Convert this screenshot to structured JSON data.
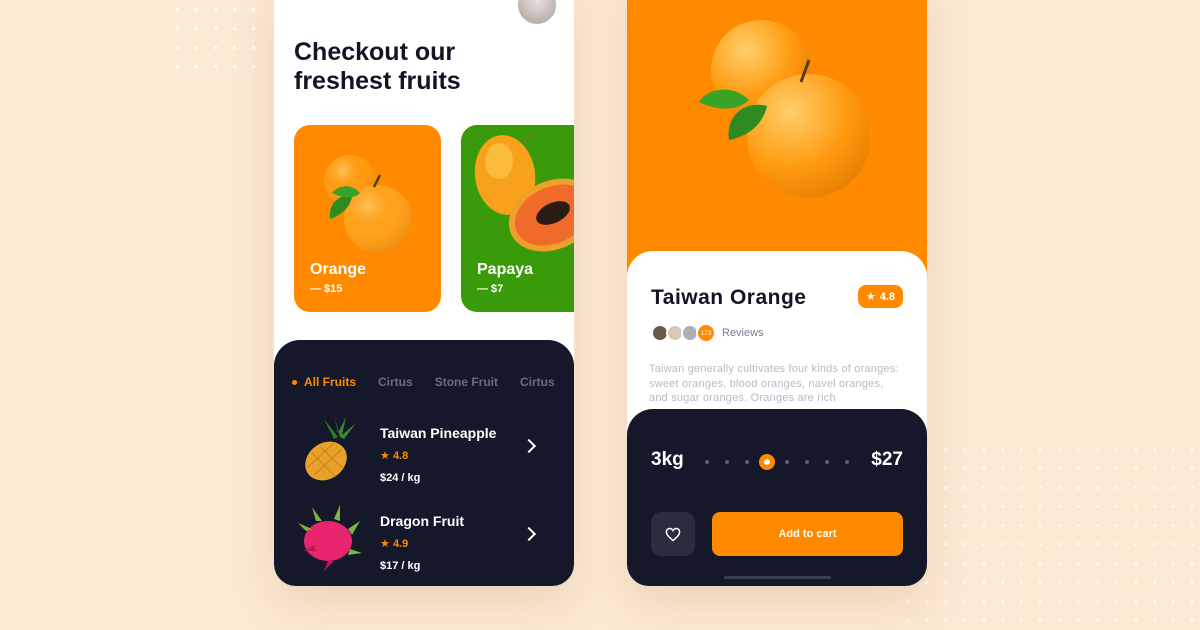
{
  "browse": {
    "headline_line1": "Checkout our",
    "headline_line2": "freshest fruits",
    "cards": [
      {
        "name": "Orange",
        "price": "— $15",
        "color": "#ff8a00",
        "icon": "orange-image"
      },
      {
        "name": "Papaya",
        "price": "— $7",
        "color": "#3a9b0a",
        "icon": "papaya-image"
      }
    ],
    "tabs": [
      "All Fruits",
      "Cirtus",
      "Stone Fruit",
      "Cirtus"
    ],
    "items": [
      {
        "name": "Taiwan Pineapple",
        "rating": "4.8",
        "price": "$24 / kg",
        "icon": "pineapple-image"
      },
      {
        "name": "Dragon Fruit",
        "rating": "4.9",
        "price": "$17 / kg",
        "icon": "dragon-fruit-image"
      }
    ]
  },
  "detail": {
    "title": "Taiwan Orange",
    "rating": "4.8",
    "review_count": "173",
    "reviews_label": "Reviews",
    "description": "Taiwan generally cultivates four kinds of oranges: sweet oranges, blood oranges, navel oranges, and sugar oranges. Oranges are rich",
    "quantity": "3kg",
    "total": "$27",
    "quantity_level": 0.375,
    "add_to_cart_label": "Add to cart"
  },
  "colors": {
    "accent": "#ff8a00",
    "dark": "#15182a",
    "background": "#fbe9d4",
    "papaya_card": "#3a9b0a"
  }
}
